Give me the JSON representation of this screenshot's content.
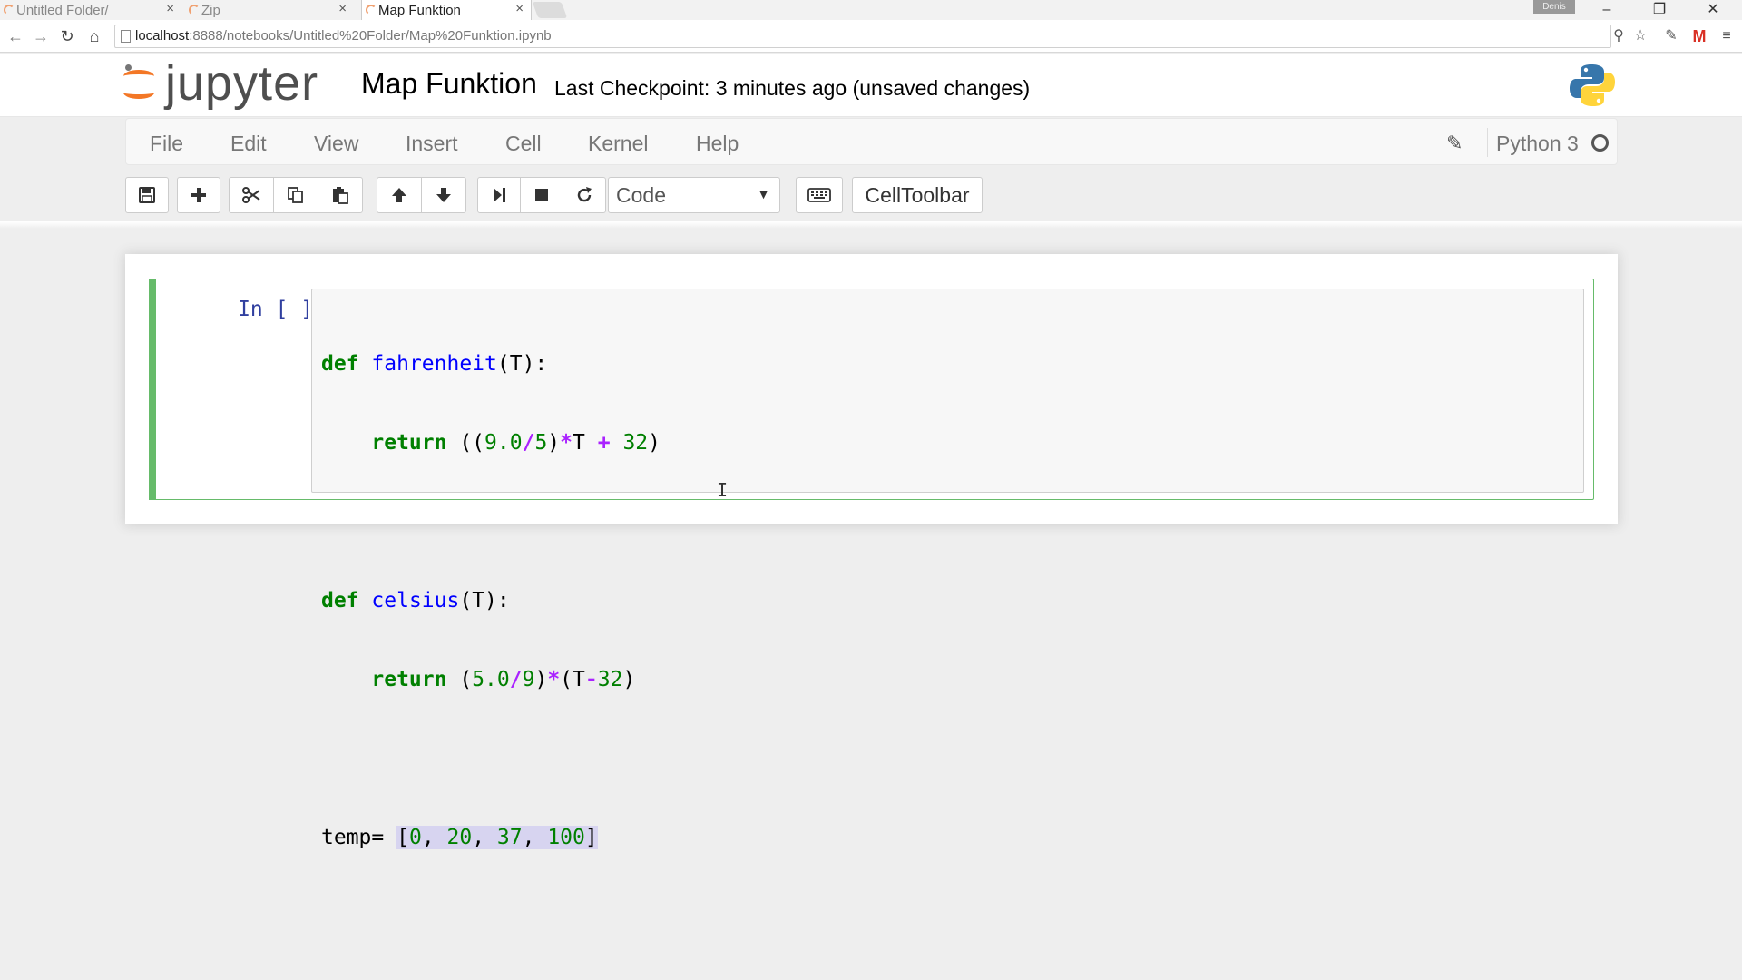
{
  "browser": {
    "tabs": [
      {
        "title": "Untitled Folder/",
        "close": "×"
      },
      {
        "title": "Zip",
        "close": "×"
      },
      {
        "title": "Map Funktion",
        "close": "×"
      }
    ],
    "user": "Denis",
    "window_controls": {
      "minimize": "–",
      "restore": "❐",
      "close": "✕"
    },
    "nav": {
      "back": "←",
      "forward": "→",
      "reload": "↻",
      "home": "⌂"
    },
    "url": {
      "host": "localhost",
      "rest": ":8888/notebooks/Untitled%20Folder/Map%20Funktion.ipynb"
    },
    "addr_icons": {
      "zoom": "⚲",
      "star": "☆",
      "pen": "✎",
      "gmail": "M",
      "menu": "≡"
    }
  },
  "header": {
    "logo_text": "jupyter",
    "notebook_name": "Map Funktion",
    "checkpoint": "Last Checkpoint: 3 minutes ago (unsaved changes)"
  },
  "menu": {
    "items": [
      "File",
      "Edit",
      "View",
      "Insert",
      "Cell",
      "Kernel",
      "Help"
    ],
    "edit_icon": "✎",
    "kernel": "Python 3"
  },
  "toolbar": {
    "cell_type": "Code",
    "cell_type_caret": "▼",
    "celltoolbar_label": "CellToolbar"
  },
  "cell": {
    "prompt": "In [ ]:",
    "code": {
      "l1": {
        "def": "def",
        "fname": "fahrenheit",
        "args": "(T):"
      },
      "l2": {
        "indent": "    ",
        "ret": "return",
        "a": " ((",
        "n1": "9.0",
        "op1": "/",
        "n2": "5",
        "b": ")",
        "op2": "*",
        "c": "T ",
        "op3": "+",
        "d": " ",
        "n3": "32",
        "e": ")"
      },
      "l4": {
        "def": "def",
        "fname": "celsius",
        "args": "(T):"
      },
      "l5": {
        "indent": "    ",
        "ret": "return",
        "a": " (",
        "n1": "5.0",
        "op1": "/",
        "n2": "9",
        "b": ")",
        "op2": "*",
        "c": "(T",
        "op3": "-",
        "n3": "32",
        "e": ")"
      },
      "l7": {
        "a": "temp= ",
        "open": "[",
        "n1": "0",
        "s1": ", ",
        "n2": "20",
        "s2": ", ",
        "n3": "37",
        "s3": ", ",
        "n4": "100",
        "close": "]"
      }
    }
  },
  "cursor_glyph": "I"
}
